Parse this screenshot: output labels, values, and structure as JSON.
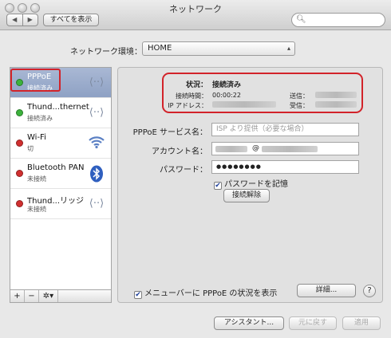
{
  "window": {
    "title": "ネットワーク"
  },
  "toolbar": {
    "back": "◀",
    "forward": "▶",
    "show_all": "すべてを表示",
    "search_placeholder": ""
  },
  "location": {
    "label": "ネットワーク環境：",
    "value": "HOME"
  },
  "services": [
    {
      "name": "PPPoE",
      "status": "接続済み",
      "status_color": "#3cb23c",
      "icon": "ethernet-icon"
    },
    {
      "name": "Thund...thernet",
      "status": "接続済み",
      "status_color": "#3cb23c",
      "icon": "ethernet-icon"
    },
    {
      "name": "Wi-Fi",
      "status": "切",
      "status_color": "#d02f2f",
      "icon": "wifi-icon"
    },
    {
      "name": "Bluetooth PAN",
      "status": "未接続",
      "status_color": "#d02f2f",
      "icon": "bluetooth-icon"
    },
    {
      "name": "Thund...リッジ",
      "status": "未接続",
      "status_color": "#d02f2f",
      "icon": "ethernet-icon"
    }
  ],
  "sidebar_footer": {
    "add": "+",
    "remove": "−",
    "action": "✲▾"
  },
  "status": {
    "label": "状況：",
    "value": "接続済み",
    "time_label": "接続時間：",
    "time_value": "00:00:22",
    "ip_label": "IP アドレス：",
    "sent_label": "送信：",
    "received_label": "受信："
  },
  "form": {
    "service_label": "PPPoE サービス名：",
    "service_placeholder": "ISP より提供（必要な場合）",
    "account_label": "アカウント名：",
    "account_at": "@",
    "password_label": "パスワード：",
    "password_value": "●●●●●●●●",
    "remember_label": "パスワードを記憶",
    "disconnect": "接続解除"
  },
  "menubar_check": "メニューバーに PPPoE の状況を表示",
  "advanced": "詳細...",
  "help": "?",
  "bottom": {
    "assistant": "アシスタント...",
    "revert": "元に戻す",
    "apply": "適用"
  },
  "colors": {
    "highlight_red": "#d2232a",
    "selection": "#9aaccd"
  }
}
